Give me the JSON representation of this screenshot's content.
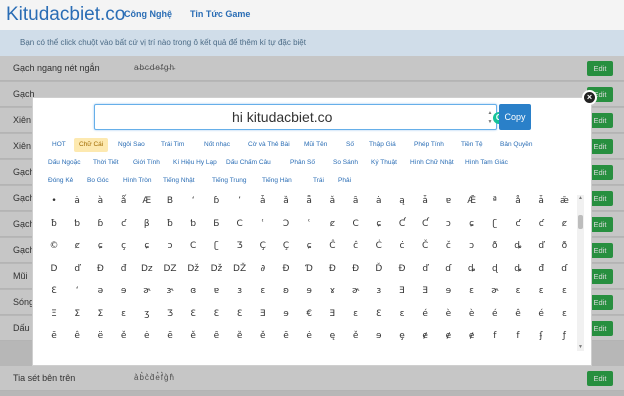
{
  "site": {
    "logo": "Kitudacbiet.co",
    "nav": [
      "Công Nghệ",
      "Tin Tức Game"
    ],
    "info": "Bạn có thể click chuột vào bất cứ vị trí nào trong ô kết quả để thêm kí tự đặc biệt"
  },
  "rows": [
    {
      "name": "Gạch ngang nét ngắn",
      "sample": "a̵b̵c̵d̵e̵f̵g̵h̵",
      "edit": "Edit"
    },
    {
      "name": "Gạch",
      "sample": "",
      "edit": "Edit"
    },
    {
      "name": "Xiên",
      "sample": "",
      "edit": "Edit"
    },
    {
      "name": "Xiên",
      "sample": "",
      "edit": "Edit"
    },
    {
      "name": "Gạch",
      "sample": "",
      "edit": "Edit"
    },
    {
      "name": "Gạch",
      "sample": "",
      "edit": "Edit"
    },
    {
      "name": "Gạch",
      "sample": "",
      "edit": "Edit"
    },
    {
      "name": "Gạch",
      "sample": "",
      "edit": "Edit"
    },
    {
      "name": "Mũi",
      "sample": "",
      "edit": "Edit"
    },
    {
      "name": "Sóng",
      "sample": "",
      "edit": "Edit"
    },
    {
      "name": "Dấu",
      "sample": "",
      "edit": "Edit"
    },
    {
      "name": "Tia sét bên trên",
      "sample": "a͛b͛c͛d͛e͛f͛g͛h͛",
      "edit": "Edit"
    }
  ],
  "modal": {
    "input_value": "hi kitudacbiet.co",
    "copy_label": "Copy",
    "close_label": "×",
    "grammarly_label": "G",
    "spin_up": "▲",
    "spin_down": "▼",
    "categories": [
      [
        "HOT",
        "Chữ Cái",
        "Ngôi Sao",
        "Trái Tim",
        "Nốt nhạc",
        "Cờ và Thẻ Bài",
        "Mũi Tên",
        "Số",
        "Thập Giá",
        "Phép Tính",
        "Tiền Tệ",
        "Bản Quyền"
      ],
      [
        "Dấu Ngoặc",
        "Thời Tiết",
        "Giới Tính",
        "Kí Hiệu Hy Lạp",
        "Dấu Chấm Câu",
        "Phân Số",
        "So Sánh",
        "Ký Thuật",
        "Hình Chữ Nhật",
        "Hình Tam Giác"
      ],
      [
        "Đóng Kẻ",
        "Bo Góc",
        "Hình Tròn",
        "Tiếng Nhật",
        "Tiếng Trung",
        "Tiếng Hàn",
        "Trái",
        "Phải"
      ]
    ],
    "active_category": "Chữ Cái",
    "symbols": [
      [
        "•",
        "ȧ",
        "à",
        "ǻ",
        "Æ",
        "B",
        "ʻ",
        "ɓ",
        "ʼ",
        "ǡ",
        "ȁ",
        "ǟ",
        "ǎ",
        "ȃ",
        "ȧ",
        "ą",
        "ǡ",
        "ɐ",
        "Ǣ",
        "ª",
        "å",
        "ǡ",
        "ǣ"
      ],
      [
        "ƀ",
        "ƅ",
        "ɓ",
        "ƈ",
        "β",
        "ƀ",
        "ƅ",
        "Ƃ",
        "C",
        "ʿ",
        "Ɔ",
        "ʿ",
        "ȼ",
        "C",
        "ɕ",
        "Ƈ",
        "Ƈ",
        "ɔ",
        "ɕ",
        "ʗ",
        "ƈ",
        "ƈ",
        "ȼ"
      ],
      [
        "©",
        "ȼ",
        "ɕ",
        "ç",
        "ɕ",
        "ɔ",
        "C",
        "ʗ",
        "Ʒ",
        "Ç",
        "Ç",
        "ɕ",
        "Ĉ",
        "ĉ",
        "Ċ",
        "ċ",
        "Č",
        "č",
        "ɔ",
        "ð",
        "ȡ",
        "ď",
        "ð"
      ],
      [
        "D",
        "ď",
        "Đ",
        "đ",
        "Dz",
        "DZ",
        "Dž",
        "Dž",
        "DŽ",
        "∂",
        "Ɖ",
        "Ɗ",
        "Ɖ",
        "Ɖ",
        "Ď",
        "Đ",
        "ď",
        "ɗ",
        "ȡ",
        "ɖ",
        "ȡ",
        "đ",
        "ɗ"
      ],
      [
        "Ɛ",
        "ʻ",
        "ə",
        "ɘ",
        "ɚ",
        "ɝ",
        "ɞ",
        "ɐ",
        "ɜ",
        "ɛ",
        "ʚ",
        "ɘ",
        "ɤ",
        "ɚ",
        "ɜ",
        "Ǝ",
        "Ǝ",
        "ɘ",
        "ɛ",
        "ɚ",
        "ɛ",
        "ɛ",
        "ɛ"
      ],
      [
        "Ξ",
        "Σ",
        "Σ",
        "ɛ",
        "ʒ",
        "Ʒ",
        "Ɛ",
        "Ɛ",
        "Ɛ",
        "Ǝ",
        "ɘ",
        "€",
        "Ǝ",
        "ɛ",
        "Ɛ",
        "ɛ",
        "é",
        "è",
        "è",
        "é",
        "ê",
        "é",
        "ɛ"
      ],
      [
        "ē",
        "ê",
        "ë",
        "ě",
        "ė",
        "ē",
        "ě",
        "ȇ",
        "ȅ",
        "ě",
        "ē",
        "ė",
        "ę",
        "ě",
        "ɘ",
        "ȩ",
        "ɇ",
        "ɇ",
        "ɇ",
        "f",
        "f",
        "ʄ",
        "ƒ"
      ]
    ]
  }
}
